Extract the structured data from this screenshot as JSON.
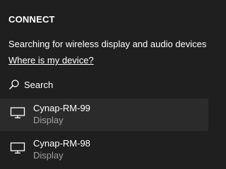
{
  "panel": {
    "title": "CONNECT",
    "status": "Searching for wireless display and audio devices",
    "help_link": "Where is my device?",
    "search_label": "Search",
    "search_icon": "search-icon"
  },
  "devices": [
    {
      "name": "Cynap-RM-99",
      "type": "Display",
      "icon": "monitor-icon",
      "selected": true
    },
    {
      "name": "Cynap-RM-98",
      "type": "Display",
      "icon": "monitor-icon",
      "selected": false
    }
  ],
  "colors": {
    "background": "#1f1f1f",
    "selected_row": "#2b2b2b",
    "text": "#ffffff",
    "secondary_text": "#a0a0a0"
  }
}
